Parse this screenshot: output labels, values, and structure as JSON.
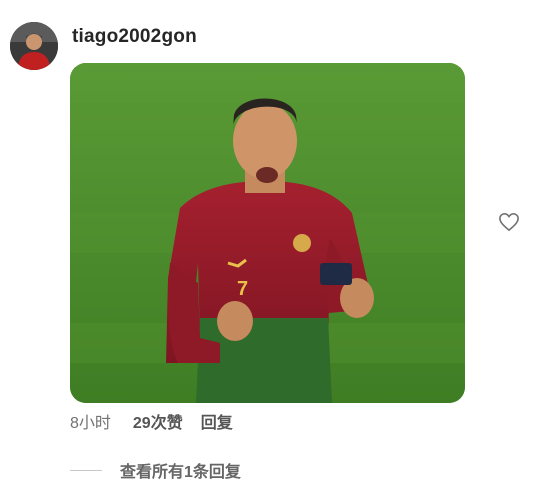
{
  "comment": {
    "username": "tiago2002gon",
    "time": "8小时",
    "likes": "29次赞",
    "reply_label": "回复",
    "view_replies": "查看所有1条回复"
  },
  "icons": {
    "like": "heart-outline-icon"
  },
  "colors": {
    "username": "#262626",
    "meta": "#737373",
    "grass": "#4a8a2c",
    "shirt": "#9b1c2a"
  }
}
